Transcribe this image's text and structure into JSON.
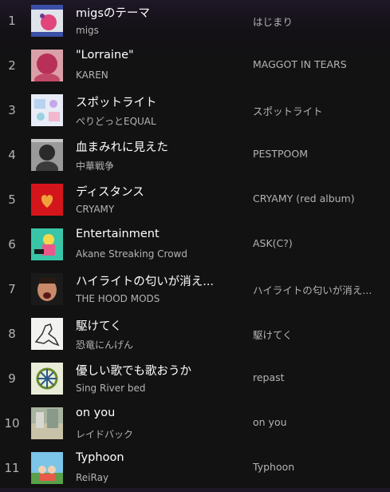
{
  "tracks": [
    {
      "index": "1",
      "title": "migsのテーマ",
      "artist": "migs",
      "album": "はじまり",
      "art_icon": "migs-album-art-icon"
    },
    {
      "index": "2",
      "title": "\"Lorraine\"",
      "artist": "KAREN",
      "album": "MAGGOT IN TEARS",
      "art_icon": "karen-album-art-icon"
    },
    {
      "index": "3",
      "title": "スポットライト",
      "artist": "ぺりどっとEQUAL",
      "album": "スポットライト",
      "art_icon": "spotlight-album-art-icon"
    },
    {
      "index": "4",
      "title": "血まみれに見えた",
      "artist": "中華戦争",
      "album": "PESTPOOM",
      "art_icon": "pestpoom-album-art-icon"
    },
    {
      "index": "5",
      "title": "ディスタンス",
      "artist": "CRYAMY",
      "album": "CRYAMY (red album)",
      "art_icon": "cryamy-red-album-art-icon"
    },
    {
      "index": "6",
      "title": "Entertainment",
      "artist": "Akane Streaking Crowd",
      "album": "ASK(C?)",
      "art_icon": "ask-album-art-icon"
    },
    {
      "index": "7",
      "title": "ハイライトの匂いが消え...",
      "artist": "THE HOOD MODS",
      "album": "ハイライトの匂いが消え...",
      "art_icon": "hood-mods-album-art-icon"
    },
    {
      "index": "8",
      "title": "駆けてく",
      "artist": "恐竜にんげん",
      "album": "駆けてく",
      "art_icon": "dinosaur-album-art-icon"
    },
    {
      "index": "9",
      "title": "優しい歌でも歌おうか",
      "artist": "Sing River bed",
      "album": "repast",
      "art_icon": "repast-album-art-icon"
    },
    {
      "index": "10",
      "title": "on you",
      "artist": "レイドバック",
      "album": "on you",
      "art_icon": "on-you-album-art-icon"
    },
    {
      "index": "11",
      "title": "Typhoon",
      "artist": "ReiRay",
      "album": "Typhoon",
      "art_icon": "typhoon-album-art-icon"
    }
  ]
}
